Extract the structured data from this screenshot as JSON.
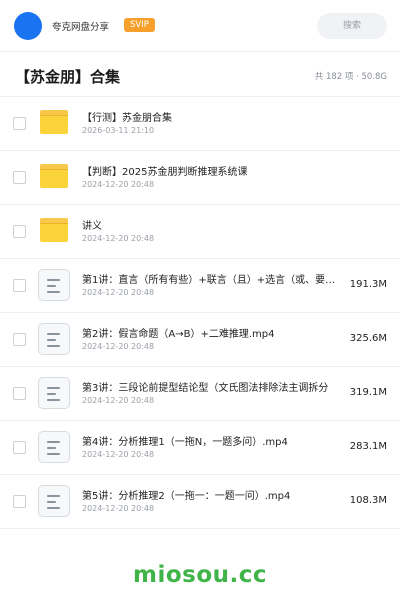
{
  "header": {
    "brand": "夸克网盘分享",
    "badge": "SVIP",
    "search_label": "搜索",
    "brand_color": "#1a73f0"
  },
  "collection": {
    "title": "【苏金朋】合集",
    "summary": "共 182 项 · 50.8G"
  },
  "items": [
    {
      "type": "folder",
      "name": "【行测】苏金朋合集",
      "date": "2026-03-11 21:10",
      "size": ""
    },
    {
      "type": "folder",
      "name": "【判断】2025苏金朋判断推理系统课",
      "date": "2024-12-20 20:48",
      "size": ""
    },
    {
      "type": "folder",
      "name": "讲义",
      "date": "2024-12-20 20:48",
      "size": ""
    },
    {
      "type": "file",
      "name": "第1讲：直言（所有有些）+联言（且）+选言（或、要…",
      "date": "2024-12-20 20:48",
      "size": "191.3M"
    },
    {
      "type": "file",
      "name": "第2讲：假言命题（A→B）+二难推理.mp4",
      "date": "2024-12-20 20:48",
      "size": "325.6M"
    },
    {
      "type": "file",
      "name": "第3讲：三段论前提型结论型（文氏图法排除法主调拆分",
      "date": "2024-12-20 20:48",
      "size": "319.1M"
    },
    {
      "type": "file",
      "name": "第4讲：分析推理1（一拖N，一题多问）.mp4",
      "date": "2024-12-20 20:48",
      "size": "283.1M"
    },
    {
      "type": "file",
      "name": "第5讲：分析推理2（一拖一：一题一问）.mp4",
      "date": "2024-12-20 20:48",
      "size": "108.3M"
    }
  ],
  "watermark": "miosou.cc"
}
